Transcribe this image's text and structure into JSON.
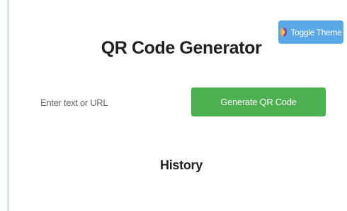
{
  "header": {
    "theme_toggle_label": "Toggle Theme",
    "theme_toggle_icon": "palette-icon"
  },
  "main": {
    "title": "QR Code Generator",
    "input_placeholder": "Enter text or URL",
    "input_value": "",
    "generate_label": "Generate QR Code",
    "history_heading": "History"
  },
  "colors": {
    "toggle_bg": "#5aa9e6",
    "generate_bg": "#4caf50",
    "text": "#222222"
  }
}
